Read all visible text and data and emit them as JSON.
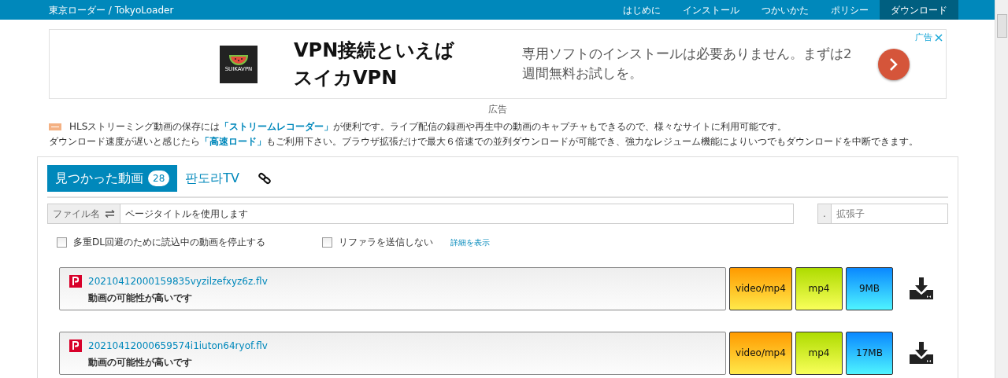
{
  "header": {
    "brand": "東京ローダー / TokyoLoader",
    "nav": [
      {
        "label": "はじめに",
        "selected": false
      },
      {
        "label": "インストール",
        "selected": false
      },
      {
        "label": "つかいかた",
        "selected": false
      },
      {
        "label": "ポリシー",
        "selected": false
      },
      {
        "label": "ダウンロード",
        "selected": true
      }
    ]
  },
  "ad": {
    "logo_text": "SUIKAVPN",
    "headline": [
      "VPN接続といえば",
      "スイカVPN"
    ],
    "description": "専用ソフトのインストールは必要ありません。まずは2週間無料お試しを。",
    "badge": "广告"
  },
  "ad_label": "広告",
  "notices": [
    {
      "before": "HLSストリーミング動画の保存には",
      "link": "「ストリームレコーダー」",
      "after": "が便利です。ライブ配信の録画や再生中の動画のキャプチャもできるので、様々なサイトに利用可能です。"
    },
    {
      "before": "ダウンロード速度が遅いと感じたら",
      "link": "「高速ロード」",
      "after": "もご利用下さい。ブラウザ拡張だけで最大６倍速での並列ダウンロードが可能でき、強力なレジューム機能によりいつでもダウンロードを中断できます。"
    }
  ],
  "tabs": [
    {
      "label": "見つかった動画",
      "count": "28",
      "selected": true
    },
    {
      "label": "판도라TV",
      "selected": false
    }
  ],
  "filename": {
    "addon": "ファイル名",
    "value": "ページタイトルを使用します"
  },
  "extension": {
    "addon": ".",
    "placeholder": "拡張子"
  },
  "options": [
    {
      "label": "多重DL回避のために読込中の動画を停止する",
      "checked": false
    },
    {
      "label": "リファラを送信しない",
      "checked": false
    }
  ],
  "details_link": "詳細を表示",
  "videos": [
    {
      "name": "20210412000159835vyzilzefxyz6z.flv",
      "note": "動画の可能性が高いです",
      "mime": "video/mp4",
      "ext": "mp4",
      "size": "9MB"
    },
    {
      "name": "20210412000659574i1iuton64ryof.flv",
      "note": "動画の可能性が高いです",
      "mime": "video/mp4",
      "ext": "mp4",
      "size": "17MB"
    }
  ]
}
